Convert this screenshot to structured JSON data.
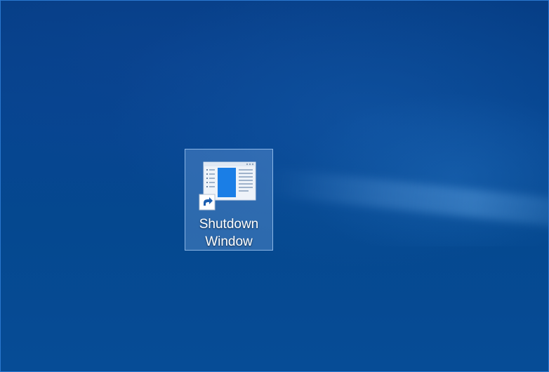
{
  "desktop": {
    "icons": [
      {
        "label_line1": "Shutdown",
        "label_line2": "Window",
        "icon": "window-app-icon",
        "shortcut_badge": "shortcut-arrow-icon",
        "selected": true
      }
    ]
  },
  "colors": {
    "wallpaper": "#064590",
    "accent": "#1e7ae0",
    "selection": "#78aae6"
  }
}
